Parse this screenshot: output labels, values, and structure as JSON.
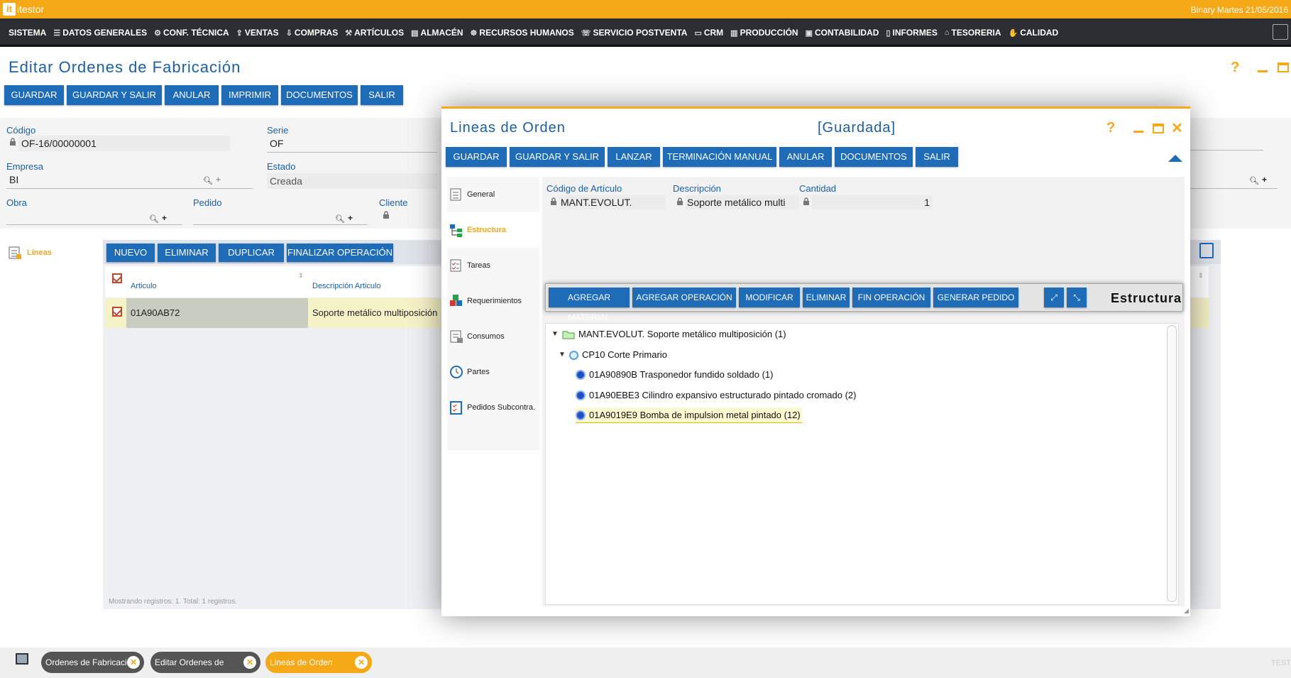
{
  "app": {
    "logo_mark": "it",
    "logo_text": "itestor",
    "datetime": "Binary Martes 21/05/2016"
  },
  "menu": [
    {
      "label": "SISTEMA",
      "icon": ""
    },
    {
      "label": "DATOS GENERALES",
      "icon": "☰"
    },
    {
      "label": "CONF. TÉCNICA",
      "icon": "⚙"
    },
    {
      "label": "VENTAS",
      "icon": "⇪"
    },
    {
      "label": "COMPRAS",
      "icon": "⇩"
    },
    {
      "label": "ARTÍCULOS",
      "icon": "⚒"
    },
    {
      "label": "ALMACÉN",
      "icon": "▤"
    },
    {
      "label": "RECURSOS HUMANOS",
      "icon": "☸"
    },
    {
      "label": "SERVICIO POSTVENTA",
      "icon": "☏"
    },
    {
      "label": "CRM",
      "icon": "▭"
    },
    {
      "label": "PRODUCCIÓN",
      "icon": "▥"
    },
    {
      "label": "CONTABILIDAD",
      "icon": "▣"
    },
    {
      "label": "INFORMES",
      "icon": "▯"
    },
    {
      "label": "TESORERIA",
      "icon": "⌂"
    },
    {
      "label": "CALIDAD",
      "icon": "✋"
    }
  ],
  "page": {
    "title": "Editar Ordenes de Fabricación",
    "help": "?",
    "buttons": [
      "GUARDAR",
      "GUARDAR Y SALIR",
      "ANULAR",
      "IMPRIMIR",
      "DOCUMENTOS",
      "SALIR"
    ],
    "fields": {
      "codigo_label": "Código",
      "codigo_value": "OF-16/00000001",
      "serie_label": "Serie",
      "serie_value": "OF",
      "empresa_label": "Empresa",
      "empresa_value": "BI",
      "estado_label": "Estado",
      "estado_value": "Creada",
      "obra_label": "Obra",
      "pedido_label": "Pedido",
      "cliente_label": "Cliente"
    },
    "lineas_label": "Líneas",
    "grid_buttons": [
      "NUEVO",
      "ELIMINAR",
      "DUPLICAR",
      "FINALIZAR OPERACIÓN"
    ],
    "grid_columns": [
      "Articulo",
      "Descripción Articulo"
    ],
    "grid_row": {
      "articulo": "01A90AB72",
      "descripcion": "Soporte metálico multiposición"
    },
    "grid_footer": "Mostrando registros: 1. Total: 1 registros."
  },
  "modal": {
    "title": "Lineas de Orden",
    "status": "[Guardada]",
    "help": "?",
    "close": "✕",
    "buttons": [
      "GUARDAR",
      "GUARDAR Y SALIR",
      "LANZAR",
      "TERMINACIÓN MANUAL",
      "ANULAR",
      "DOCUMENTOS",
      "SALIR"
    ],
    "sidebar": [
      {
        "label": "General"
      },
      {
        "label": "Estructura",
        "active": true
      },
      {
        "label": "Tareas"
      },
      {
        "label": "Requerimientos"
      },
      {
        "label": "Consumos"
      },
      {
        "label": "Partes"
      },
      {
        "label": "Pedidos Subcontra."
      }
    ],
    "fields": {
      "codigo_label": "Código de Artículo",
      "codigo_value": "MANT.EVOLUT.",
      "descripcion_label": "Descripción",
      "descripcion_value": "Soporte metálico multi",
      "cantidad_label": "Cantidad",
      "cantidad_value": "1"
    },
    "struct_buttons": [
      "AGREGAR MATERIAL",
      "AGREGAR OPERACIÓN",
      "MODIFICAR",
      "ELIMINAR",
      "FIN OPERACIÓN",
      "GENERAR PEDIDO"
    ],
    "expand_icon": "⤢",
    "compress_icon": "⤡",
    "struct_title": "Estructura",
    "tree": {
      "root": "MANT.EVOLUT. Soporte metálico multiposición (1)",
      "operation": "CP10 Corte Primario",
      "materials": [
        "01A90890B Trasponedor fundido soldado (1)",
        "01A90EBE3 Cilindro expansivo estructurado pintado cromado (2)",
        "01A9019E9 Bomba de impulsion metal pintado (12)"
      ]
    }
  },
  "taskbar": {
    "tabs": [
      "Ordenes de Fabricación",
      "Editar Ordenes de",
      "Lineas de Orden"
    ],
    "close": "✕",
    "right_text": "TEST"
  },
  "colors": {
    "accent": "#f5a916",
    "primary": "#1e6bb8",
    "menubar": "#2a2d31",
    "title": "#1b5fa8"
  }
}
